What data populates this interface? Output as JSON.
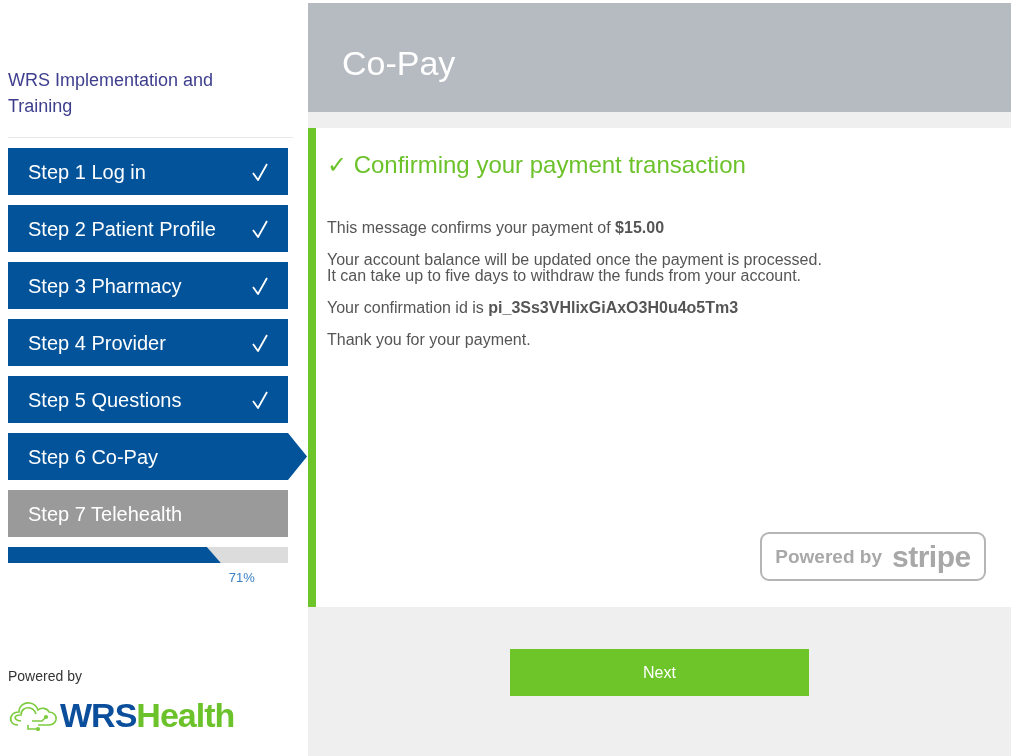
{
  "sidebar": {
    "title": "WRS Implementation and Training",
    "steps": [
      {
        "label": "Step 1 Log in",
        "completed": true,
        "selected": false,
        "disabled": false
      },
      {
        "label": "Step 2 Patient Profile",
        "completed": true,
        "selected": false,
        "disabled": false
      },
      {
        "label": "Step 3 Pharmacy",
        "completed": true,
        "selected": false,
        "disabled": false
      },
      {
        "label": "Step 4 Provider",
        "completed": true,
        "selected": false,
        "disabled": false
      },
      {
        "label": "Step 5 Questions",
        "completed": true,
        "selected": false,
        "disabled": false
      },
      {
        "label": "Step 6 Co-Pay",
        "completed": false,
        "selected": true,
        "disabled": false
      },
      {
        "label": "Step 7 Telehealth",
        "completed": false,
        "selected": false,
        "disabled": true
      }
    ],
    "progress": {
      "level": 0.71,
      "label": "71%"
    },
    "powered_by": "Powered by",
    "logo": {
      "text_primary": "WRS",
      "text_accent": "Health"
    }
  },
  "header": {
    "title": "Co-Pay"
  },
  "confirmation": {
    "heading": "✓ Confirming your payment transaction",
    "paragraphs": [
      [
        "This message confirms your payment of **$15.00**"
      ],
      [
        "Your account balance will be updated once the payment is processed.",
        "It can take up to five days to withdraw the funds from your account."
      ],
      [
        "Your confirmation id is **pi_3Ss3VHlixGiAxO3H0u4o5Tm3**"
      ],
      [
        "Thank you for your payment."
      ]
    ],
    "provider_badge": {
      "prefix": "Powered by",
      "brand": "stripe"
    }
  },
  "next_button": "Next"
}
